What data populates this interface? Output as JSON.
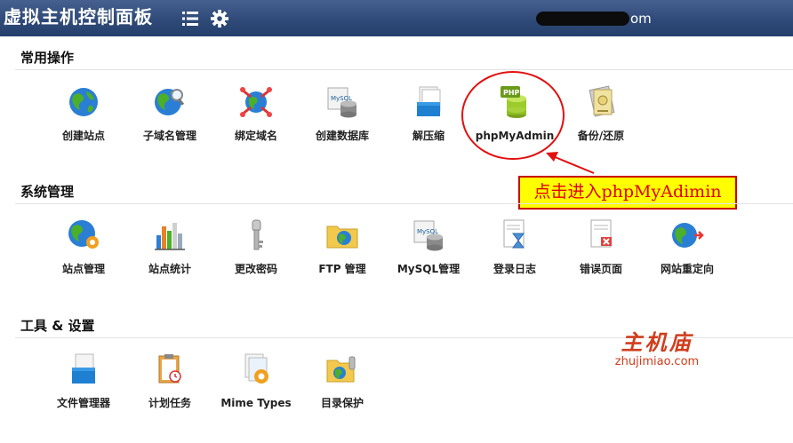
{
  "header": {
    "title": "虚拟主机控制面板",
    "menu_icon": "list-icon",
    "settings_icon": "gear-icon",
    "user_suffix": "om"
  },
  "sections": [
    {
      "title": "常用操作",
      "items": [
        {
          "label": "创建站点",
          "icon": "globe-icon"
        },
        {
          "label": "子域名管理",
          "icon": "globe-search-icon"
        },
        {
          "label": "绑定域名",
          "icon": "domain-bind-icon"
        },
        {
          "label": "创建数据库",
          "icon": "mysql-database-icon"
        },
        {
          "label": "解压缩",
          "icon": "archive-icon"
        },
        {
          "label": "phpMyAdmin",
          "icon": "php-database-icon"
        },
        {
          "label": "备份/还原",
          "icon": "backup-icon"
        }
      ]
    },
    {
      "title": "系统管理",
      "items": [
        {
          "label": "站点管理",
          "icon": "globe-gear-icon"
        },
        {
          "label": "站点统计",
          "icon": "bar-chart-icon"
        },
        {
          "label": "更改密码",
          "icon": "key-icon"
        },
        {
          "label": "FTP 管理",
          "icon": "ftp-folder-icon"
        },
        {
          "label": "MySQL管理",
          "icon": "mysql-admin-icon"
        },
        {
          "label": "登录日志",
          "icon": "log-hourglass-icon"
        },
        {
          "label": "错误页面",
          "icon": "error-page-icon"
        },
        {
          "label": "网站重定向",
          "icon": "redirect-globe-icon"
        }
      ]
    },
    {
      "title": "工具 & 设置",
      "items": [
        {
          "label": "文件管理器",
          "icon": "file-manager-icon"
        },
        {
          "label": "计划任务",
          "icon": "clipboard-task-icon"
        },
        {
          "label": "Mime Types",
          "icon": "mime-gear-icon"
        },
        {
          "label": "目录保护",
          "icon": "folder-protect-icon"
        }
      ]
    }
  ],
  "annotation": {
    "text": "点击进入phpMyAdimin"
  },
  "watermark": {
    "cn": "主机庙",
    "en": "zhujimiao.com"
  },
  "colors": {
    "header_bg": "#2f4a78",
    "annotation_red": "#e21010",
    "annotation_fill": "#ffff00",
    "watermark": "#d13d1d"
  }
}
